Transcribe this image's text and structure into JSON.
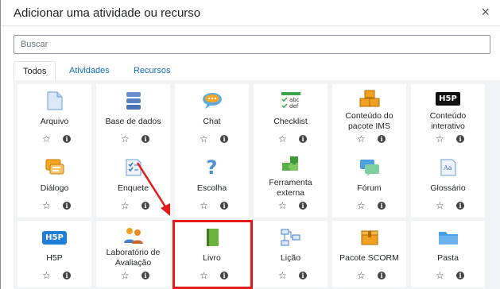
{
  "dialog": {
    "title": "Adicionar uma atividade ou recurso",
    "close_glyph": "×"
  },
  "search": {
    "placeholder": "Buscar",
    "value": ""
  },
  "tabs": [
    {
      "label": "Todos",
      "active": true
    },
    {
      "label": "Atividades",
      "active": false
    },
    {
      "label": "Recursos",
      "active": false
    }
  ],
  "modules": [
    {
      "label": "Arquivo",
      "icon": "file-icon"
    },
    {
      "label": "Base de dados",
      "icon": "database-icon"
    },
    {
      "label": "Chat",
      "icon": "chat-icon"
    },
    {
      "label": "Checklist",
      "icon": "checklist-icon"
    },
    {
      "label": "Conteúdo do pacote IMS",
      "icon": "ims-package-icon"
    },
    {
      "label": "Conteúdo interativo",
      "icon": "h5p-icon"
    },
    {
      "label": "Diálogo",
      "icon": "dialogue-icon"
    },
    {
      "label": "Enquete",
      "icon": "survey-icon"
    },
    {
      "label": "Escolha",
      "icon": "question-icon"
    },
    {
      "label": "Ferramenta externa",
      "icon": "puzzle-icon"
    },
    {
      "label": "Fórum",
      "icon": "forum-icon"
    },
    {
      "label": "Glossário",
      "icon": "glossary-icon"
    },
    {
      "label": "H5P",
      "icon": "h5p-icon"
    },
    {
      "label": "Laboratório de Avaliação",
      "icon": "workshop-icon"
    },
    {
      "label": "Livro",
      "icon": "book-icon"
    },
    {
      "label": "Lição",
      "icon": "lesson-icon"
    },
    {
      "label": "Pacote SCORM",
      "icon": "scorm-icon"
    },
    {
      "label": "Pasta",
      "icon": "folder-icon"
    }
  ],
  "icon_text": {
    "h5p": "H5P",
    "abc": "abc",
    "def": "def",
    "aa": "Aa"
  },
  "star_glyph": "☆",
  "info_glyph": "i",
  "colors": {
    "accent": "#0f6cbf",
    "highlight": "#e31b1b",
    "book_green": "#6bb33c"
  }
}
